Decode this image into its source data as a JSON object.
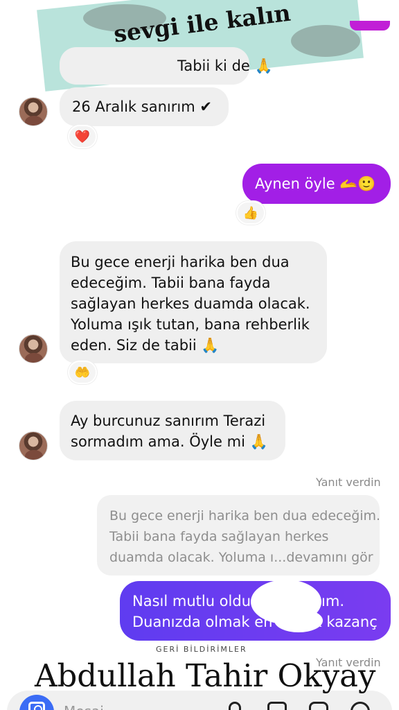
{
  "banner": {
    "text": "sevgi ile kalın"
  },
  "messages": {
    "m1_partial": "Tabii ki de 🙏",
    "m2": "26 Aralık sanırım ✔",
    "m3": "Aynen öyle 🫴🙂",
    "m4_lines": [
      "Bu gece enerji harika ben dua",
      "edeceğim. Tabii bana fayda",
      "sağlayan herkes duamda olacak.",
      "Yoluma ışık tutan, bana rehberlik",
      "eden. Siz de tabii 🙏"
    ],
    "m5_lines": [
      "Ay burcunuz sanırım Terazi",
      "sormadım ama. Öyle mi 🙏"
    ],
    "reply_label": "Yanıt verdin",
    "quote_lines": [
      "Bu gece enerji harika ben dua edeceğim.",
      "Tabii bana fayda sağlayan herkes",
      "duamda olacak. Yoluma ı...devamını gör"
    ],
    "m6_lines": [
      "Nasıl mutlu oldu         Hanım.",
      "Duanızda olmak en büyük kazanç"
    ],
    "reply_label_2": "Yanıt verdin"
  },
  "reactions": {
    "r1": "❤️",
    "r2": "👍",
    "r3": "🤲"
  },
  "footer": {
    "feedback": "GERİ BİLDİRİMLER",
    "watermark": "Abdullah Tahir Okyay",
    "input_placeholder": "Mesaj..."
  },
  "colors": {
    "outgoing_purple": "#a21fe6",
    "outgoing_blue": "#6a3cf0",
    "camera": "#3b6cf5",
    "banner": "#b9e3db"
  }
}
